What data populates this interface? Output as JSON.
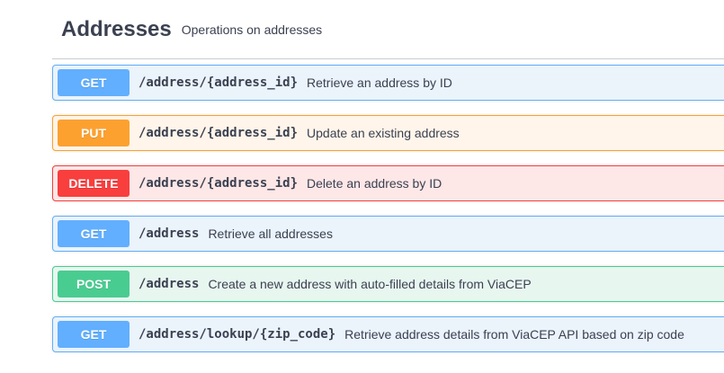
{
  "section": {
    "title": "Addresses",
    "description": "Operations on addresses"
  },
  "operations": [
    {
      "method": "GET",
      "path": "/address/{address_id}",
      "summary": "Retrieve an address by ID",
      "color": "#61affe"
    },
    {
      "method": "PUT",
      "path": "/address/{address_id}",
      "summary": "Update an existing address",
      "color": "#fca130"
    },
    {
      "method": "DELETE",
      "path": "/address/{address_id}",
      "summary": "Delete an address by ID",
      "color": "#f93e3e"
    },
    {
      "method": "GET",
      "path": "/address",
      "summary": "Retrieve all addresses",
      "color": "#61affe"
    },
    {
      "method": "POST",
      "path": "/address",
      "summary": "Create a new address with auto-filled details from ViaCEP",
      "color": "#49cc90"
    },
    {
      "method": "GET",
      "path": "/address/lookup/{zip_code}",
      "summary": "Retrieve address details from ViaCEP API based on zip code",
      "color": "#61affe"
    }
  ]
}
